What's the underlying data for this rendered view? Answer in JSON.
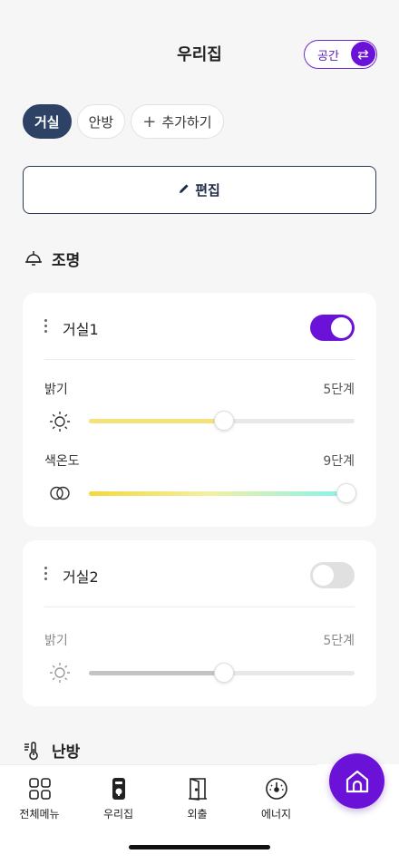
{
  "header": {
    "title": "우리집",
    "space_label": "공간"
  },
  "rooms": [
    {
      "label": "거실"
    },
    {
      "label": "안방"
    },
    {
      "label": "추가하기"
    }
  ],
  "edit_label": "편집",
  "sections": {
    "lighting": "조명",
    "heating": "난방"
  },
  "lights": [
    {
      "name": "거실1",
      "on": true,
      "brightness_label": "밝기",
      "brightness_value": "5단계",
      "brightness_level": 0.51,
      "color_temp_label": "색온도",
      "color_temp_value": "9단계",
      "color_temp_level": 1.0
    },
    {
      "name": "거실2",
      "on": false,
      "brightness_label": "밝기",
      "brightness_value": "5단계",
      "brightness_level": 0.51
    }
  ],
  "nav": [
    {
      "label": "전체메뉴",
      "icon": "grid-icon"
    },
    {
      "label": "우리집",
      "icon": "door-lock-icon"
    },
    {
      "label": "외출",
      "icon": "exit-door-icon"
    },
    {
      "label": "에너지",
      "icon": "gauge-icon"
    }
  ],
  "colors": {
    "accent": "#6a12d8",
    "active_chip": "#2d4265",
    "brightness_fill": "#f5e27a",
    "brightness_fill_off": "#c4c4c4"
  }
}
